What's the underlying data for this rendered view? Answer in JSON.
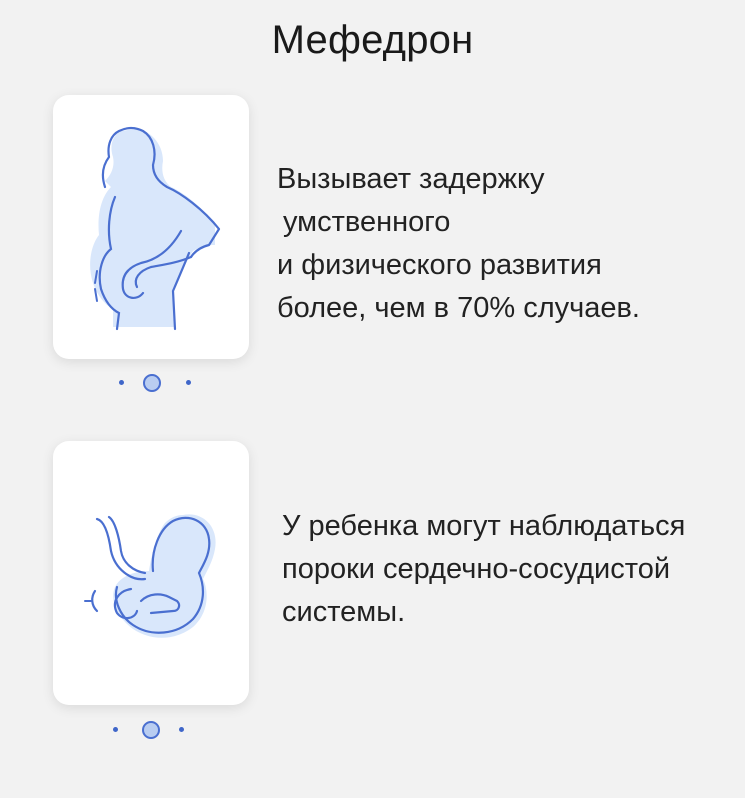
{
  "title": "Мефедрон",
  "cards": [
    {
      "icon": "pregnant-woman-icon",
      "lines": [
        "Вызывает задержку",
        "умственного",
        "и физического развития",
        "более, чем в 70% случаев."
      ],
      "pager_active": 2
    },
    {
      "icon": "fetus-icon",
      "lines": [
        "У ребенка могут наблюдаться",
        "пороки сердечно-сосудистой",
        "системы."
      ],
      "pager_active": 2
    }
  ],
  "colors": {
    "background": "#f2f2f2",
    "card": "#ffffff",
    "accent": "#3f66c9",
    "fill": "#d9e7fb"
  }
}
